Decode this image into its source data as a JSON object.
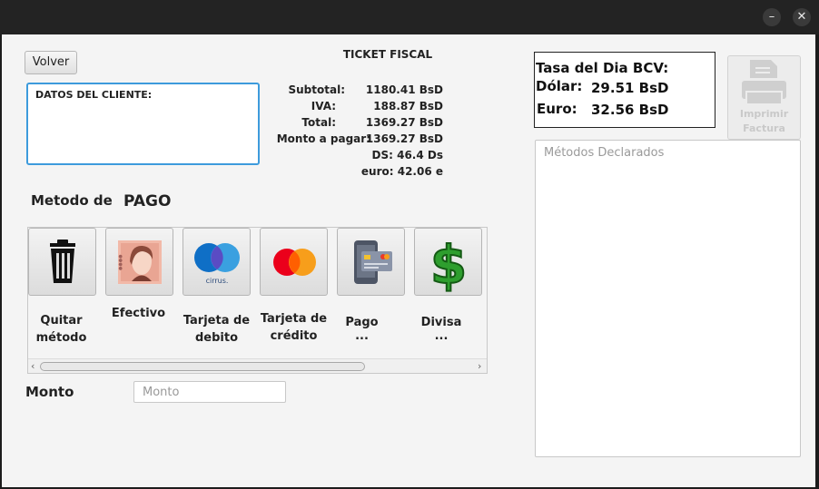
{
  "window": {
    "minimize_icon": "–",
    "close_icon": "✕"
  },
  "volver": "Volver",
  "cliente": {
    "label": "DATOS DEL CLIENTE:"
  },
  "ticket": {
    "title": "TICKET FISCAL",
    "rows": [
      {
        "label": "Subtotal:",
        "value": "1180.41 BsD"
      },
      {
        "label": "IVA:",
        "value": "188.87 BsD"
      },
      {
        "label": "Total:",
        "value": "1369.27 BsD"
      },
      {
        "label": "Monto a pagar:",
        "value": "1369.27 BsD"
      },
      {
        "label": "",
        "value": "DS: 46.4 Ds"
      },
      {
        "label": "",
        "value": "euro: 42.06 e"
      }
    ]
  },
  "metodo": {
    "prefix": "Metodo de",
    "title": "PAGO"
  },
  "methods": [
    {
      "label_1": "Quitar",
      "label_2": "método",
      "icon": "trash-icon"
    },
    {
      "label_1": "Efectivo",
      "label_2": "",
      "icon": "cash-icon"
    },
    {
      "label_1": "Tarjeta de",
      "label_2": "debito",
      "icon": "debit-card-icon"
    },
    {
      "label_1": "Tarjeta de",
      "label_2": "crédito",
      "icon": "credit-card-icon"
    },
    {
      "label_1": "Pago ...",
      "label_2": "",
      "icon": "payment-terminal-icon"
    },
    {
      "label_1": "Divisa ...",
      "label_2": "",
      "icon": "dollar-icon"
    }
  ],
  "cirrus_text": "cirrus.",
  "monto": {
    "label": "Monto",
    "placeholder": "Monto"
  },
  "tasa": {
    "title": "Tasa del Dia BCV:",
    "dolar_label": "Dólar:",
    "dolar_value": "29.51 BsD",
    "euro_label": "Euro:",
    "euro_value": "32.56 BsD"
  },
  "imprimir": {
    "line1": "Imprimir",
    "line2": "Factura"
  },
  "declarados": {
    "placeholder": "Métodos Declarados"
  },
  "colors": {
    "focus_blue": "#3d9bdc",
    "maestro_blue": "#0f6fc6",
    "master_red": "#eb001b",
    "master_orange": "#f79e1b",
    "dollar_green": "#2e9e2e"
  }
}
